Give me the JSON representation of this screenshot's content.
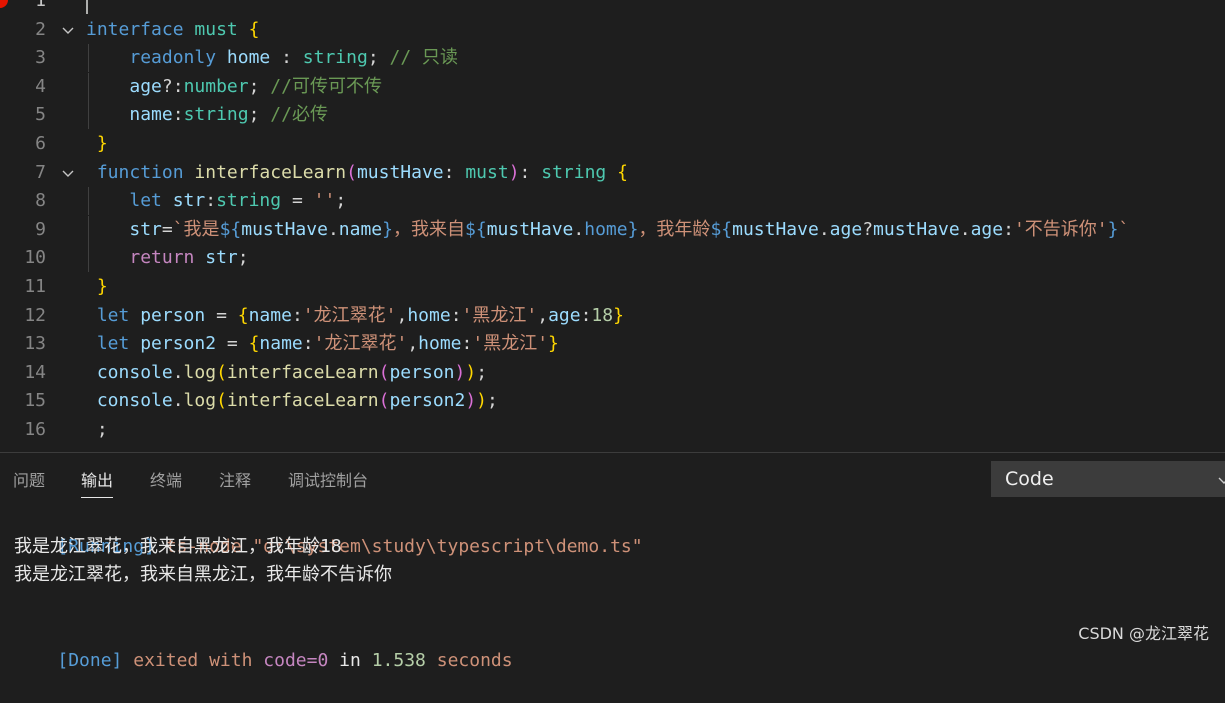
{
  "editor": {
    "lines": [
      {
        "num": "1",
        "tokens": []
      },
      {
        "num": "2",
        "tokens": [
          {
            "c": "t-kw",
            "t": "interface"
          },
          {
            "c": "t-p",
            "t": " "
          },
          {
            "c": "t-type",
            "t": "must"
          },
          {
            "c": "t-p",
            "t": " "
          },
          {
            "c": "b1",
            "t": "{"
          }
        ]
      },
      {
        "num": "3",
        "tokens": [
          {
            "c": "t-p",
            "t": "    "
          },
          {
            "c": "t-kw",
            "t": "readonly"
          },
          {
            "c": "t-p",
            "t": " "
          },
          {
            "c": "t-id",
            "t": "home"
          },
          {
            "c": "t-p",
            "t": " : "
          },
          {
            "c": "t-type",
            "t": "string"
          },
          {
            "c": "t-p",
            "t": "; "
          },
          {
            "c": "t-cm",
            "t": "// 只读"
          }
        ]
      },
      {
        "num": "4",
        "tokens": [
          {
            "c": "t-p",
            "t": "    "
          },
          {
            "c": "t-id",
            "t": "age"
          },
          {
            "c": "t-p",
            "t": "?:"
          },
          {
            "c": "t-type",
            "t": "number"
          },
          {
            "c": "t-p",
            "t": "; "
          },
          {
            "c": "t-cm",
            "t": "//可传可不传"
          }
        ]
      },
      {
        "num": "5",
        "tokens": [
          {
            "c": "t-p",
            "t": "    "
          },
          {
            "c": "t-id",
            "t": "name"
          },
          {
            "c": "t-p",
            "t": ":"
          },
          {
            "c": "t-type",
            "t": "string"
          },
          {
            "c": "t-p",
            "t": "; "
          },
          {
            "c": "t-cm",
            "t": "//必传"
          }
        ]
      },
      {
        "num": "6",
        "tokens": [
          {
            "c": "t-p",
            "t": " "
          },
          {
            "c": "b1",
            "t": "}"
          }
        ]
      },
      {
        "num": "7",
        "tokens": [
          {
            "c": "t-p",
            "t": " "
          },
          {
            "c": "t-kw",
            "t": "function"
          },
          {
            "c": "t-p",
            "t": " "
          },
          {
            "c": "t-fn",
            "t": "interfaceLearn"
          },
          {
            "c": "b2",
            "t": "("
          },
          {
            "c": "t-id",
            "t": "mustHave"
          },
          {
            "c": "t-p",
            "t": ": "
          },
          {
            "c": "t-type",
            "t": "must"
          },
          {
            "c": "b2",
            "t": ")"
          },
          {
            "c": "t-p",
            "t": ": "
          },
          {
            "c": "t-type",
            "t": "string"
          },
          {
            "c": "t-p",
            "t": " "
          },
          {
            "c": "b1",
            "t": "{"
          }
        ]
      },
      {
        "num": "8",
        "tokens": [
          {
            "c": "t-p",
            "t": "    "
          },
          {
            "c": "t-kw",
            "t": "let"
          },
          {
            "c": "t-p",
            "t": " "
          },
          {
            "c": "t-id",
            "t": "str"
          },
          {
            "c": "t-p",
            "t": ":"
          },
          {
            "c": "t-type",
            "t": "string"
          },
          {
            "c": "t-p",
            "t": " = "
          },
          {
            "c": "t-str",
            "t": "''"
          },
          {
            "c": "t-p",
            "t": ";"
          }
        ]
      },
      {
        "num": "9",
        "tokens": [
          {
            "c": "t-p",
            "t": "    "
          },
          {
            "c": "t-id",
            "t": "str"
          },
          {
            "c": "t-p",
            "t": "="
          },
          {
            "c": "t-str",
            "t": "`我是"
          },
          {
            "c": "t-kw",
            "t": "${"
          },
          {
            "c": "t-id",
            "t": "mustHave"
          },
          {
            "c": "t-p",
            "t": "."
          },
          {
            "c": "t-id",
            "t": "name"
          },
          {
            "c": "t-kw",
            "t": "}"
          },
          {
            "c": "t-str",
            "t": "，我来自"
          },
          {
            "c": "t-kw",
            "t": "${"
          },
          {
            "c": "t-id",
            "t": "mustHave"
          },
          {
            "c": "t-p",
            "t": "."
          },
          {
            "c": "t-kw",
            "t": "home"
          },
          {
            "c": "t-kw",
            "t": "}"
          },
          {
            "c": "t-str",
            "t": "，我年龄"
          },
          {
            "c": "t-kw",
            "t": "${"
          },
          {
            "c": "t-id",
            "t": "mustHave"
          },
          {
            "c": "t-p",
            "t": "."
          },
          {
            "c": "t-id",
            "t": "age"
          },
          {
            "c": "t-p",
            "t": "?"
          },
          {
            "c": "t-id",
            "t": "mustHave"
          },
          {
            "c": "t-p",
            "t": "."
          },
          {
            "c": "t-id",
            "t": "age"
          },
          {
            "c": "t-p",
            "t": ":"
          },
          {
            "c": "t-str",
            "t": "'不告诉你'"
          },
          {
            "c": "t-kw",
            "t": "}"
          },
          {
            "c": "t-str",
            "t": "`"
          }
        ]
      },
      {
        "num": "10",
        "tokens": [
          {
            "c": "t-p",
            "t": "    "
          },
          {
            "c": "t-ctl",
            "t": "return"
          },
          {
            "c": "t-p",
            "t": " "
          },
          {
            "c": "t-id",
            "t": "str"
          },
          {
            "c": "t-p",
            "t": ";"
          }
        ]
      },
      {
        "num": "11",
        "tokens": [
          {
            "c": "t-p",
            "t": " "
          },
          {
            "c": "b1",
            "t": "}"
          }
        ]
      },
      {
        "num": "12",
        "tokens": [
          {
            "c": "t-p",
            "t": " "
          },
          {
            "c": "t-kw",
            "t": "let"
          },
          {
            "c": "t-p",
            "t": " "
          },
          {
            "c": "t-id",
            "t": "person"
          },
          {
            "c": "t-p",
            "t": " = "
          },
          {
            "c": "b1",
            "t": "{"
          },
          {
            "c": "t-id",
            "t": "name"
          },
          {
            "c": "t-p",
            "t": ":"
          },
          {
            "c": "t-str",
            "t": "'龙江翠花'"
          },
          {
            "c": "t-p",
            "t": ","
          },
          {
            "c": "t-id",
            "t": "home"
          },
          {
            "c": "t-p",
            "t": ":"
          },
          {
            "c": "t-str",
            "t": "'黑龙江'"
          },
          {
            "c": "t-p",
            "t": ","
          },
          {
            "c": "t-id",
            "t": "age"
          },
          {
            "c": "t-p",
            "t": ":"
          },
          {
            "c": "t-num",
            "t": "18"
          },
          {
            "c": "b1",
            "t": "}"
          }
        ]
      },
      {
        "num": "13",
        "tokens": [
          {
            "c": "t-p",
            "t": " "
          },
          {
            "c": "t-kw",
            "t": "let"
          },
          {
            "c": "t-p",
            "t": " "
          },
          {
            "c": "t-id",
            "t": "person2"
          },
          {
            "c": "t-p",
            "t": " = "
          },
          {
            "c": "b1",
            "t": "{"
          },
          {
            "c": "t-id",
            "t": "name"
          },
          {
            "c": "t-p",
            "t": ":"
          },
          {
            "c": "t-str",
            "t": "'龙江翠花'"
          },
          {
            "c": "t-p",
            "t": ","
          },
          {
            "c": "t-id",
            "t": "home"
          },
          {
            "c": "t-p",
            "t": ":"
          },
          {
            "c": "t-str",
            "t": "'黑龙江'"
          },
          {
            "c": "b1",
            "t": "}"
          }
        ]
      },
      {
        "num": "14",
        "tokens": [
          {
            "c": "t-p",
            "t": " "
          },
          {
            "c": "t-id",
            "t": "console"
          },
          {
            "c": "t-p",
            "t": "."
          },
          {
            "c": "t-fn",
            "t": "log"
          },
          {
            "c": "b1",
            "t": "("
          },
          {
            "c": "t-fn",
            "t": "interfaceLearn"
          },
          {
            "c": "b2",
            "t": "("
          },
          {
            "c": "t-id",
            "t": "person"
          },
          {
            "c": "b2",
            "t": ")"
          },
          {
            "c": "b1",
            "t": ")"
          },
          {
            "c": "t-p",
            "t": ";"
          }
        ]
      },
      {
        "num": "15",
        "tokens": [
          {
            "c": "t-p",
            "t": " "
          },
          {
            "c": "t-id",
            "t": "console"
          },
          {
            "c": "t-p",
            "t": "."
          },
          {
            "c": "t-fn",
            "t": "log"
          },
          {
            "c": "b1",
            "t": "("
          },
          {
            "c": "t-fn",
            "t": "interfaceLearn"
          },
          {
            "c": "b2",
            "t": "("
          },
          {
            "c": "t-id",
            "t": "person2"
          },
          {
            "c": "b2",
            "t": ")"
          },
          {
            "c": "b1",
            "t": ")"
          },
          {
            "c": "t-p",
            "t": ";"
          }
        ]
      },
      {
        "num": "16",
        "tokens": [
          {
            "c": "t-p",
            "t": " ;"
          }
        ]
      }
    ]
  },
  "panel": {
    "tabs": [
      {
        "label": "问题",
        "active": false
      },
      {
        "label": "输出",
        "active": true
      },
      {
        "label": "终端",
        "active": false
      },
      {
        "label": "注释",
        "active": false
      },
      {
        "label": "调试控制台",
        "active": false
      }
    ],
    "channel": "Code",
    "output": {
      "running_tag": "[Running]",
      "command": "ts-node \"d:\\system\\study\\typescript\\demo.ts\"",
      "result_1": "我是龙江翠花，我来自黑龙江，我年龄18",
      "result_2": "我是龙江翠花，我来自黑龙江，我年龄不告诉你",
      "done_tag": "[Done]",
      "exited_with": "exited with",
      "code_label": "code=0",
      "in_label": "in",
      "duration": "1.538",
      "seconds_label": "seconds"
    }
  },
  "watermark": "CSDN @龙江翠花",
  "colors": {
    "editor_bg": "#1e1e1e",
    "keyword": "#569cd6",
    "type": "#4ec9b0",
    "function": "#dcdcaa",
    "string": "#ce9178",
    "comment": "#6a9955",
    "number": "#b5cea8",
    "error": "#e51400"
  }
}
